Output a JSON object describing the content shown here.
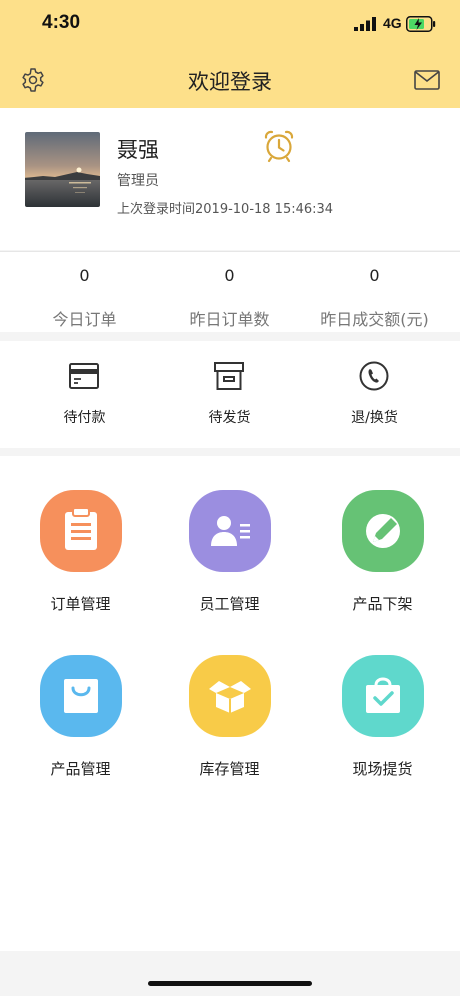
{
  "status_bar": {
    "time": "4:30",
    "network": "4G"
  },
  "header": {
    "title": "欢迎登录"
  },
  "profile": {
    "name": "聂强",
    "role": "管理员",
    "last_login": "上次登录时间2019-10-18 15:46:34"
  },
  "stats": [
    {
      "value": "0",
      "label": "今日订单"
    },
    {
      "value": "0",
      "label": "昨日订单数"
    },
    {
      "value": "0",
      "label": "昨日成交额(元)"
    }
  ],
  "order_status": [
    {
      "label": "待付款",
      "icon": "card-icon"
    },
    {
      "label": "待发货",
      "icon": "box-icon"
    },
    {
      "label": "退/换货",
      "icon": "phone-icon"
    }
  ],
  "modules": [
    {
      "label": "订单管理",
      "icon": "clipboard-icon",
      "color": "#f6905c"
    },
    {
      "label": "员工管理",
      "icon": "employee-card-icon",
      "color": "#9b8ee0"
    },
    {
      "label": "产品下架",
      "icon": "pen-icon",
      "color": "#66c275"
    },
    {
      "label": "产品管理",
      "icon": "shopping-bag-icon",
      "color": "#5ab8ee"
    },
    {
      "label": "库存管理",
      "icon": "open-box-icon",
      "color": "#f8cb48"
    },
    {
      "label": "现场提货",
      "icon": "check-bag-icon",
      "color": "#5fd8cc"
    }
  ],
  "colors": {
    "header_bg": "#fde08a",
    "alarm": "#d9a73a"
  }
}
